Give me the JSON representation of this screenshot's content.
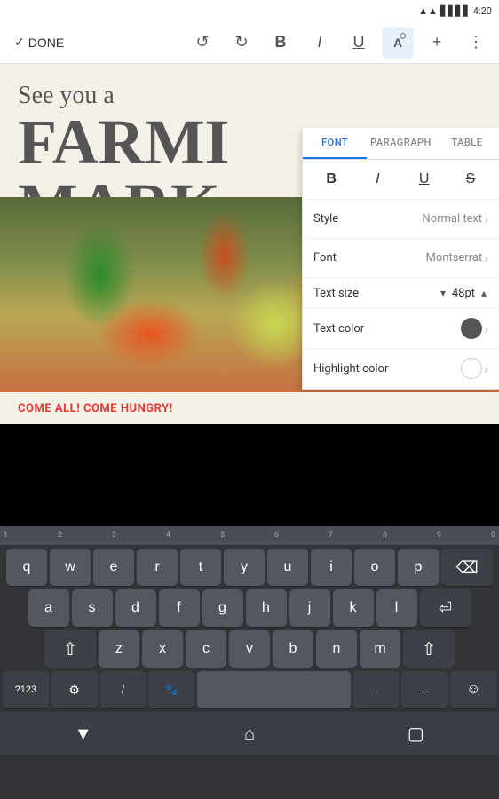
{
  "statusBar": {
    "time": "4:20",
    "wifiIcon": "wifi",
    "signalIcon": "signal",
    "batteryIcon": "battery"
  },
  "toolbar": {
    "doneLabel": "DONE",
    "undoLabel": "↺",
    "redoLabel": "↻",
    "boldLabel": "B",
    "italicLabel": "I",
    "underlineLabel": "U",
    "textFormatLabel": "A",
    "addLabel": "+",
    "moreLabel": "⋮"
  },
  "fontPanel": {
    "tabs": [
      "FONT",
      "PARAGRAPH",
      "TABLE"
    ],
    "activeTab": "FONT",
    "formatButtons": [
      "B",
      "I",
      "U",
      "S"
    ],
    "styleLabel": "Style",
    "styleValue": "Normal text",
    "fontLabel": "Font",
    "fontValue": "Montserrat",
    "textSizeLabel": "Text size",
    "textSizeValue": "48pt",
    "textColorLabel": "Text color",
    "highlightColorLabel": "Highlight color"
  },
  "document": {
    "line1": "See you a",
    "line2": "FARMI",
    "line3": "MARK",
    "redText": "COME ALL! COME HUNGRY!"
  },
  "keyboard": {
    "rulerNumbers": [
      "1",
      "2",
      "3",
      "4",
      "5",
      "6",
      "7",
      "8",
      "9",
      "0"
    ],
    "row1": [
      "q",
      "w",
      "e",
      "r",
      "t",
      "y",
      "u",
      "i",
      "o",
      "p"
    ],
    "row2": [
      "a",
      "s",
      "d",
      "f",
      "g",
      "h",
      "j",
      "k",
      "l"
    ],
    "row3": [
      "z",
      "x",
      "c",
      "v",
      "b",
      "n",
      "m"
    ],
    "specialKeys": {
      "shift": "⇧",
      "backspace": "⌫",
      "numbers": "?123",
      "settings": "⚙",
      "slash": "/",
      "emoji": "☺",
      "enter": "⏎",
      "comma": ",",
      "period": "...",
      "mic": "🐾"
    },
    "navButtons": [
      "▼",
      "⌂",
      "▢"
    ]
  }
}
